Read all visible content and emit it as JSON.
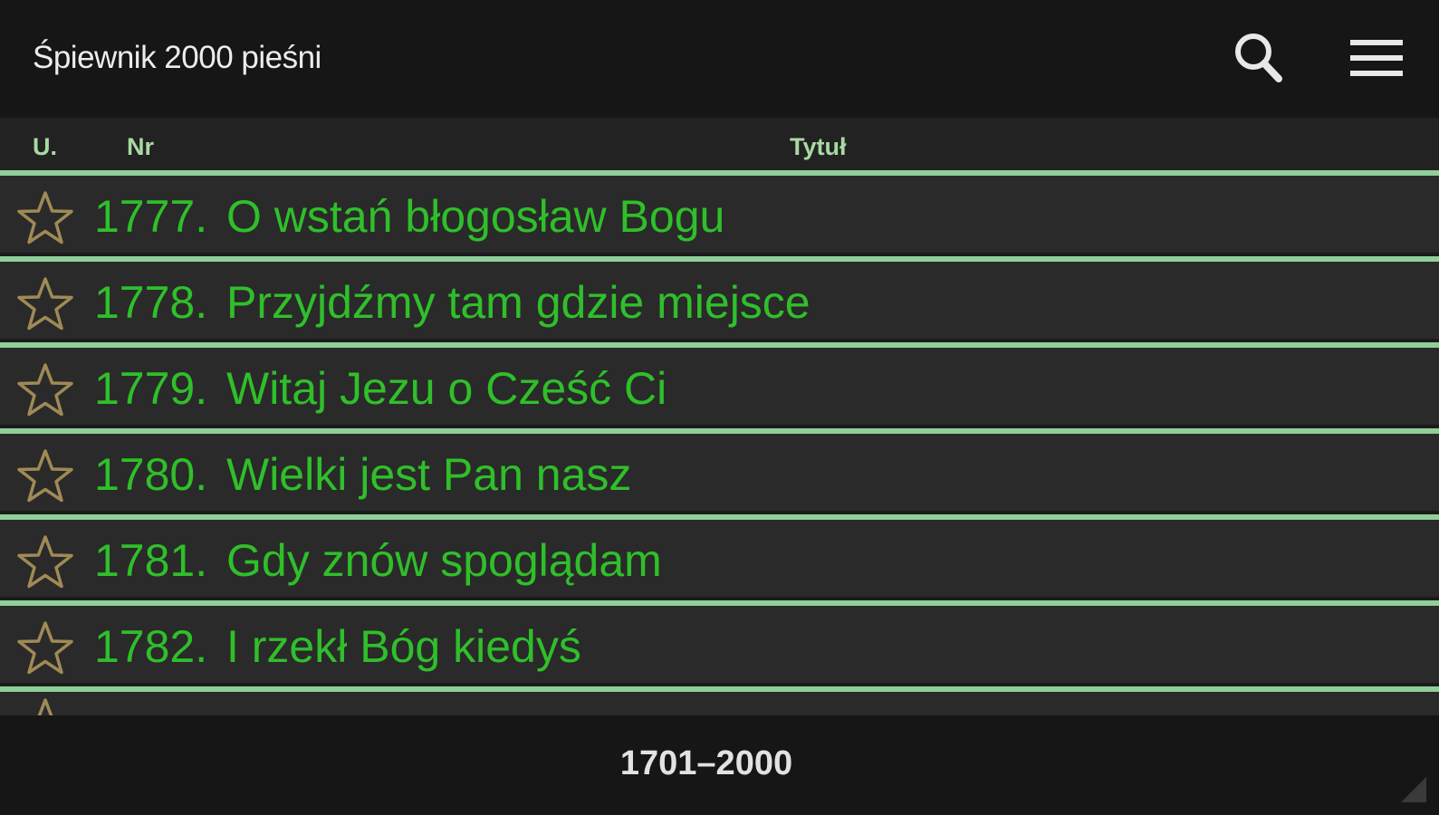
{
  "app_bar": {
    "title": "Śpiewnik 2000 pieśni",
    "icons": [
      "search-icon",
      "menu-icon"
    ]
  },
  "columns": {
    "fav": "U.",
    "number": "Nr",
    "title": "Tytuł"
  },
  "songs": [
    {
      "number": "1777.",
      "title": "O wstań błogosław Bogu"
    },
    {
      "number": "1778.",
      "title": "Przyjdźmy tam gdzie miejsce"
    },
    {
      "number": "1779.",
      "title": "Witaj Jezu o Cześć Ci"
    },
    {
      "number": "1780.",
      "title": "Wielki jest Pan nasz"
    },
    {
      "number": "1781.",
      "title": "Gdy znów spoglądam"
    },
    {
      "number": "1782.",
      "title": "I rzekł Bóg kiedyś"
    }
  ],
  "range": "1701–2000",
  "colors": {
    "accent_green": "#2fbf2a",
    "separator_green": "#8fcf99",
    "header_text": "#a9d9a3",
    "star_outline": "#a08a55"
  }
}
